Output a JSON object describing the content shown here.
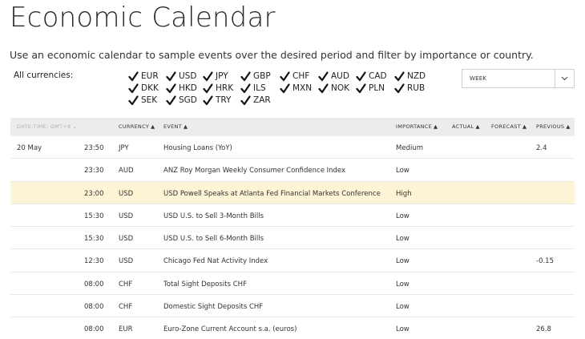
{
  "page": {
    "title": "Economic Calendar",
    "subtitle": "Use an economic calendar to sample events over the desired period and filter by importance or country."
  },
  "filters": {
    "label": "All currencies:",
    "currencies": [
      {
        "code": "EUR",
        "checked": true
      },
      {
        "code": "USD",
        "checked": true
      },
      {
        "code": "JPY",
        "checked": true
      },
      {
        "code": "GBP",
        "checked": true
      },
      {
        "code": "CHF",
        "checked": true
      },
      {
        "code": "AUD",
        "checked": true
      },
      {
        "code": "CAD",
        "checked": true
      },
      {
        "code": "NZD",
        "checked": true
      },
      {
        "code": "DKK",
        "checked": true
      },
      {
        "code": "HKD",
        "checked": true
      },
      {
        "code": "HRK",
        "checked": true
      },
      {
        "code": "ILS",
        "checked": true
      },
      {
        "code": "MXN",
        "checked": true
      },
      {
        "code": "NOK",
        "checked": true
      },
      {
        "code": "PLN",
        "checked": true
      },
      {
        "code": "RUB",
        "checked": true
      },
      {
        "code": "SEK",
        "checked": true
      },
      {
        "code": "SGD",
        "checked": true
      },
      {
        "code": "TRY",
        "checked": true
      },
      {
        "code": "ZAR",
        "checked": true
      }
    ],
    "period": {
      "value": "WEEK",
      "icon": "chevron-down-icon"
    }
  },
  "table": {
    "headers": {
      "datetime": "DATE-TIME: GMT+8",
      "currency": "CURRENCY",
      "event": "EVENT",
      "importance": "IMPORTANCE",
      "actual": "ACTUAL",
      "forecast": "FORECAST",
      "previous": "PREVIOUS"
    },
    "rows": [
      {
        "date": "20 May",
        "time": "23:50",
        "currency": "JPY",
        "event": "Housing Loans (YoY)",
        "importance": "Medium",
        "actual": "",
        "forecast": "",
        "previous": "2.4",
        "highlight": false
      },
      {
        "date": "",
        "time": "23:30",
        "currency": "AUD",
        "event": "ANZ Roy Morgan Weekly Consumer Confidence Index",
        "importance": "Low",
        "actual": "",
        "forecast": "",
        "previous": "",
        "highlight": false
      },
      {
        "date": "",
        "time": "23:00",
        "currency": "USD",
        "event": "USD Powell Speaks at Atlanta Fed Financial Markets Conference",
        "importance": "High",
        "actual": "",
        "forecast": "",
        "previous": "",
        "highlight": true
      },
      {
        "date": "",
        "time": "15:30",
        "currency": "USD",
        "event": "USD U.S. to Sell 3-Month Bills",
        "importance": "Low",
        "actual": "",
        "forecast": "",
        "previous": "",
        "highlight": false
      },
      {
        "date": "",
        "time": "15:30",
        "currency": "USD",
        "event": "USD U.S. to Sell 6-Month Bills",
        "importance": "Low",
        "actual": "",
        "forecast": "",
        "previous": "",
        "highlight": false
      },
      {
        "date": "",
        "time": "12:30",
        "currency": "USD",
        "event": "Chicago Fed Nat Activity Index",
        "importance": "Low",
        "actual": "",
        "forecast": "",
        "previous": "-0.15",
        "highlight": false
      },
      {
        "date": "",
        "time": "08:00",
        "currency": "CHF",
        "event": "Total Sight Deposits CHF",
        "importance": "Low",
        "actual": "",
        "forecast": "",
        "previous": "",
        "highlight": false
      },
      {
        "date": "",
        "time": "08:00",
        "currency": "CHF",
        "event": "Domestic Sight Deposits CHF",
        "importance": "Low",
        "actual": "",
        "forecast": "",
        "previous": "",
        "highlight": false
      },
      {
        "date": "",
        "time": "08:00",
        "currency": "EUR",
        "event": "Euro-Zone Current Account s.a. (euros)",
        "importance": "Low",
        "actual": "",
        "forecast": "",
        "previous": "26.8",
        "highlight": false
      }
    ]
  },
  "colors": {
    "highlight_row": "#fdf4d6",
    "header_bg": "#ececec"
  }
}
